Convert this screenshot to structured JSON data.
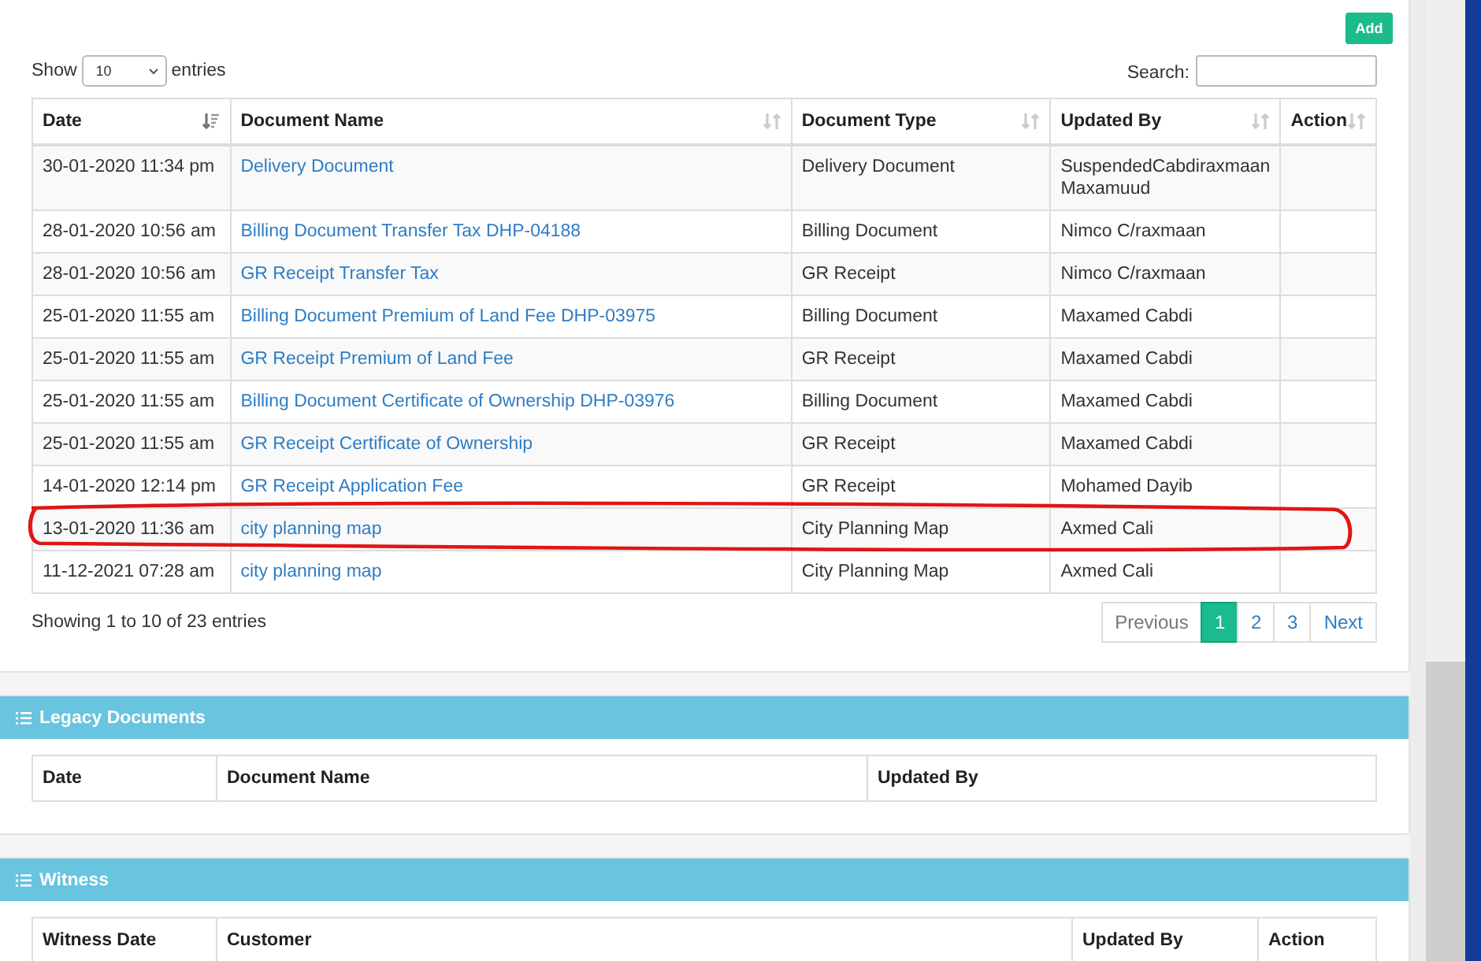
{
  "add_button": "Add",
  "length": {
    "show": "Show",
    "value": "10",
    "entries": "entries"
  },
  "search": {
    "label": "Search:"
  },
  "table": {
    "columns": [
      {
        "label": "Date",
        "sorted": true
      },
      {
        "label": "Document Name",
        "sorted": false
      },
      {
        "label": "Document Type",
        "sorted": false
      },
      {
        "label": "Updated By",
        "sorted": false
      },
      {
        "label": "Action",
        "sorted": false
      }
    ],
    "rows": [
      {
        "date": "30-01-2020 11:34 pm",
        "name": "Delivery Document",
        "type": "Delivery Document",
        "updated_by": "SuspendedCabdiraxmaan Maxamuud",
        "circled": false
      },
      {
        "date": "28-01-2020 10:56 am",
        "name": "Billing Document Transfer Tax DHP-04188",
        "type": "Billing Document",
        "updated_by": "Nimco C/raxmaan",
        "circled": false
      },
      {
        "date": "28-01-2020 10:56 am",
        "name": "GR Receipt Transfer Tax",
        "type": "GR Receipt",
        "updated_by": "Nimco C/raxmaan",
        "circled": false
      },
      {
        "date": "25-01-2020 11:55 am",
        "name": "Billing Document Premium of Land Fee DHP-03975",
        "type": "Billing Document",
        "updated_by": "Maxamed Cabdi",
        "circled": false
      },
      {
        "date": "25-01-2020 11:55 am",
        "name": "GR Receipt Premium of Land Fee",
        "type": "GR Receipt",
        "updated_by": "Maxamed Cabdi",
        "circled": false
      },
      {
        "date": "25-01-2020 11:55 am",
        "name": "Billing Document Certificate of Ownership DHP-03976",
        "type": "Billing Document",
        "updated_by": "Maxamed Cabdi",
        "circled": false
      },
      {
        "date": "25-01-2020 11:55 am",
        "name": "GR Receipt Certificate of Ownership",
        "type": "GR Receipt",
        "updated_by": "Maxamed Cabdi",
        "circled": false
      },
      {
        "date": "14-01-2020 12:14 pm",
        "name": "GR Receipt Application Fee",
        "type": "GR Receipt",
        "updated_by": "Mohamed Dayib",
        "circled": false
      },
      {
        "date": "13-01-2020 11:36 am",
        "name": "city planning map",
        "type": "City Planning Map",
        "updated_by": "Axmed Cali",
        "circled": true
      },
      {
        "date": "11-12-2021 07:28 am",
        "name": "city planning map",
        "type": "City Planning Map",
        "updated_by": "Axmed Cali",
        "circled": false
      }
    ]
  },
  "info": "Showing 1 to 10 of 23 entries",
  "pagination": [
    {
      "label": "Previous",
      "selected": false,
      "disabled": true
    },
    {
      "label": "1",
      "selected": true,
      "disabled": false
    },
    {
      "label": "2",
      "selected": false,
      "disabled": false
    },
    {
      "label": "3",
      "selected": false,
      "disabled": false
    },
    {
      "label": "Next",
      "selected": false,
      "disabled": false
    }
  ],
  "sections": [
    {
      "title": "Legacy Documents",
      "columns": [
        "Date",
        "Document Name",
        "Updated By"
      ]
    },
    {
      "title": "Witness",
      "columns": [
        "Witness Date",
        "Customer",
        "Updated By",
        "Action"
      ]
    }
  ]
}
